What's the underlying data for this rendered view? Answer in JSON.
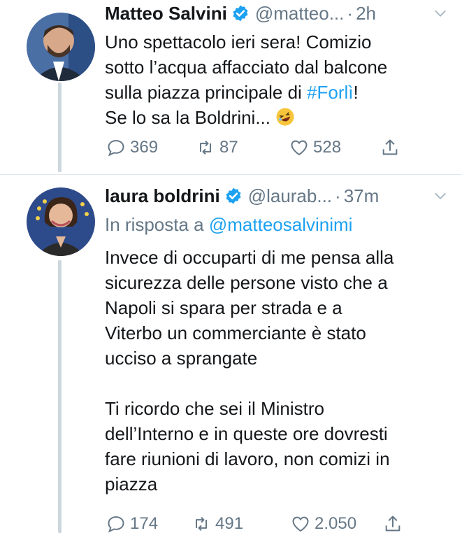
{
  "tweets": [
    {
      "author": "Matteo Salvini",
      "handle": "@matteo...",
      "separator": "·",
      "time": "2h",
      "hashtag": "#Forlì",
      "text_before_hashtag_lines": [
        "Uno spettacolo ieri sera! Comizio",
        "sotto l’acqua affacciato dal balcone",
        "sulla piazza principale di "
      ],
      "text_after_hashtag": "!",
      "last_line": "Se lo sa la Boldrini...",
      "emoji": "rolling-on-floor-laughing",
      "replies": "369",
      "retweets": "87",
      "likes": "528"
    },
    {
      "author": "laura boldrini",
      "handle": "@laurab...",
      "separator": "·",
      "time": "37m",
      "reply_prefix": "In risposta a ",
      "reply_to": "@matteosalvinimi",
      "paragraph1": [
        "Invece di occuparti di me pensa alla",
        "sicurezza delle persone visto che a",
        "Napoli si spara per strada e a",
        "Viterbo un commerciante è stato",
        "ucciso a sprangate"
      ],
      "paragraph2": [
        "Ti ricordo che sei il Ministro",
        "dell’Interno e in queste ore dovresti",
        "fare riunioni di lavoro, non comizi in",
        "piazza"
      ],
      "replies": "174",
      "retweets": "491",
      "likes": "2.050"
    }
  ],
  "colors": {
    "link": "#1da1f2",
    "muted": "#657786",
    "text": "#14171a",
    "verified": "#1da1f2"
  },
  "icons": [
    "verified-badge-icon",
    "chevron-down-icon",
    "reply-icon",
    "retweet-icon",
    "like-icon",
    "share-icon"
  ]
}
